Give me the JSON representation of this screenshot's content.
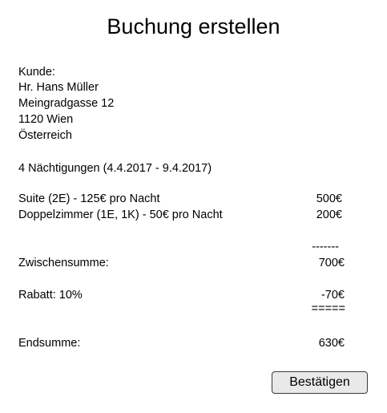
{
  "title": "Buchung erstellen",
  "customer": {
    "label": "Kunde:",
    "name": "Hr. Hans Müller",
    "street": "Meingradgasse 12",
    "city": "1120 Wien",
    "country": "Österreich"
  },
  "stay": "4 Nächtigungen (4.4.2017 - 9.4.2017)",
  "rooms": [
    {
      "label": "Suite (2E) - 125€ pro Nacht",
      "amount": "500€"
    },
    {
      "label": "Doppelzimmer (1E, 1K) - 50€ pro Nacht",
      "amount": "200€"
    }
  ],
  "separator_single": "-------",
  "subtotal": {
    "label": "Zwischensumme:",
    "amount": "700€"
  },
  "discount": {
    "label": "Rabatt: 10%",
    "amount": "-70€"
  },
  "separator_double": "=====",
  "total": {
    "label": "Endsumme:",
    "amount": "630€"
  },
  "confirm_label": "Bestätigen"
}
